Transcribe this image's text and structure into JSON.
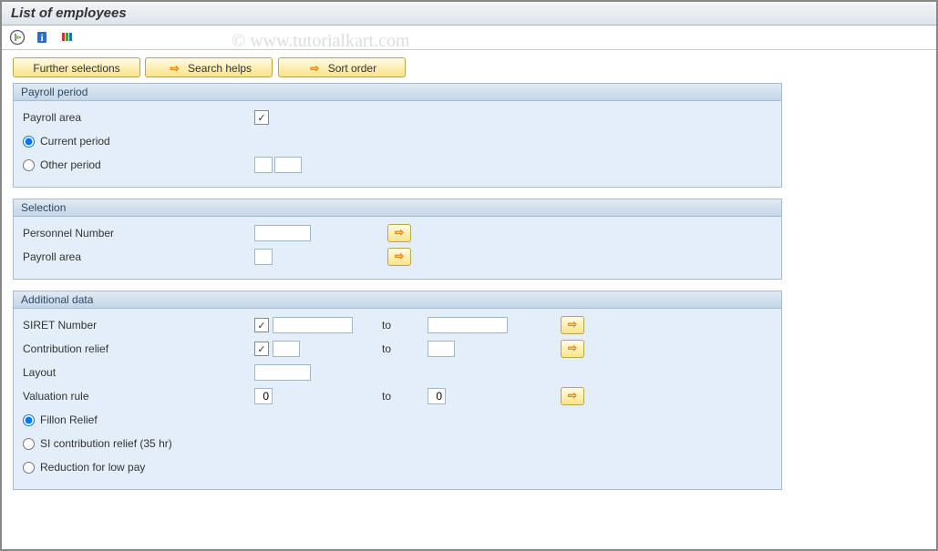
{
  "title": "List of employees",
  "watermark": "© www.tutorialkart.com",
  "buttons": {
    "further_selections": "Further selections",
    "search_helps": "Search helps",
    "sort_order": "Sort order"
  },
  "groups": {
    "payroll_period": {
      "title": "Payroll period",
      "payroll_area_label": "Payroll area",
      "payroll_area_checked": "✓",
      "current_period_label": "Current period",
      "other_period_label": "Other period",
      "other_period_val1": "",
      "other_period_val2": ""
    },
    "selection": {
      "title": "Selection",
      "personnel_number_label": "Personnel Number",
      "personnel_number_value": "",
      "payroll_area_label": "Payroll area",
      "payroll_area_value": ""
    },
    "additional": {
      "title": "Additional data",
      "siret_label": "SIRET Number",
      "siret_checked": "✓",
      "siret_from": "",
      "to_label": "to",
      "siret_to": "",
      "contrib_label": "Contribution relief",
      "contrib_checked": "✓",
      "contrib_from": "",
      "contrib_to": "",
      "layout_label": "Layout",
      "layout_value": "",
      "valuation_label": "Valuation rule",
      "valuation_from": "0",
      "valuation_to": "0",
      "fillon_label": "Fillon Relief",
      "si35_label": "SI contribution relief (35 hr)",
      "lowpay_label": "Reduction for low pay"
    }
  },
  "arrow_glyph": "⇨"
}
